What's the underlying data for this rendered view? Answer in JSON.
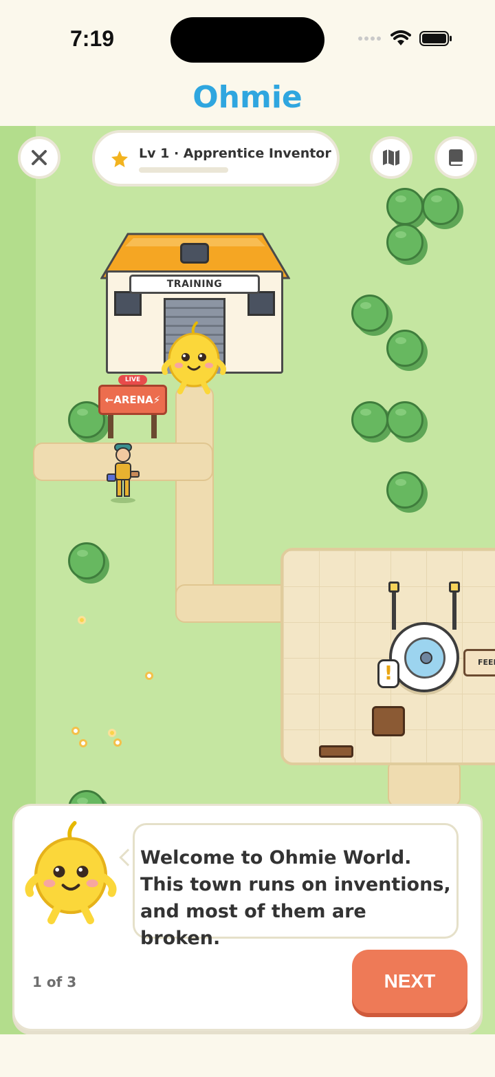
{
  "status_bar": {
    "time": "7:19"
  },
  "app": {
    "title": "Ohmie"
  },
  "hud": {
    "close_icon": "close-icon",
    "level_label": "Lv 1 · Apprentice Inventor",
    "level_progress": 0,
    "map_icon": "map-icon",
    "book_icon": "book-icon"
  },
  "world": {
    "building_sign": "TRAINING",
    "live_badge": "LIVE",
    "arena_sign": "←ARENA⚡",
    "feed_sign": "FEED",
    "quest_marker": "!"
  },
  "dialog": {
    "message": "Welcome to Ohmie World. This town runs on inventions, and most of them are broken.",
    "page_indicator": "1 of 3",
    "next_label": "NEXT"
  },
  "colors": {
    "accent": "#2fa6df",
    "next_button": "#ee7a57",
    "grass": "#c5e6a1",
    "star": "#f2b31f"
  }
}
